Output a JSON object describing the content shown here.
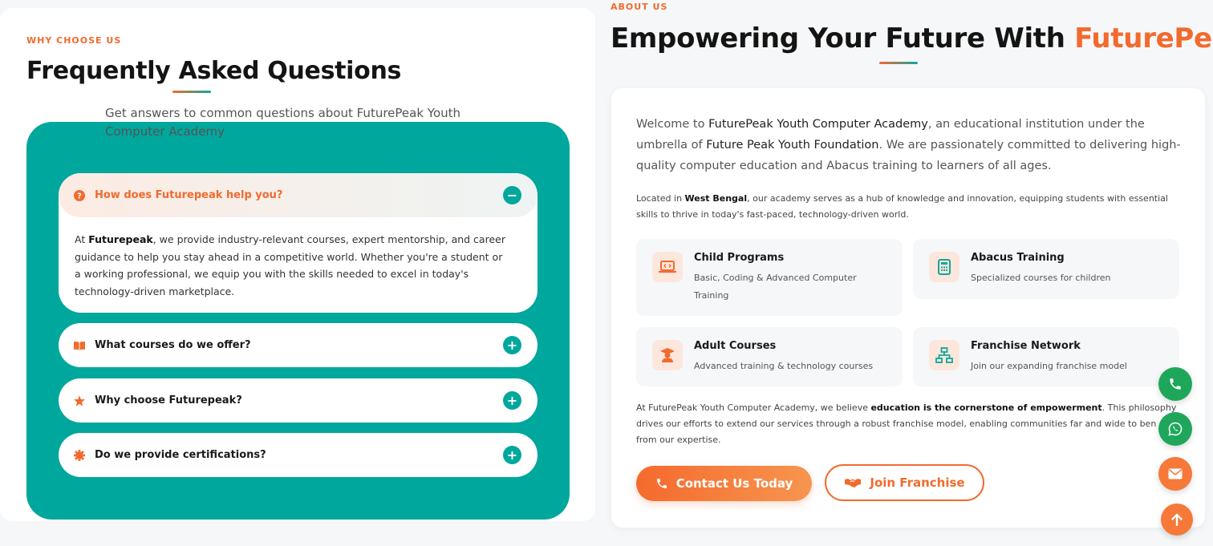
{
  "faq": {
    "eyebrow": "WHY CHOOSE US",
    "title": "Frequently Asked Questions",
    "subtitle": "Get answers to common questions about FuturePeak Youth Computer Academy",
    "items": [
      {
        "question": "How does Futurepeak help you?",
        "icon": "question-circle-icon",
        "expanded": true,
        "answer_prefix": "At ",
        "answer_bold": "Futurepeak",
        "answer_rest": ", we provide industry-relevant courses, expert mentorship, and career guidance to help you stay ahead in a competitive world. Whether you're a student or a working professional, we equip you with the skills needed to excel in today's technology-driven marketplace.",
        "toggle": "−"
      },
      {
        "question": "What courses do we offer?",
        "icon": "book-icon",
        "expanded": false,
        "toggle": "+"
      },
      {
        "question": "Why choose Futurepeak?",
        "icon": "star-icon",
        "expanded": false,
        "toggle": "+"
      },
      {
        "question": "Do we provide certifications?",
        "icon": "certificate-icon",
        "expanded": false,
        "toggle": "+"
      }
    ]
  },
  "about": {
    "eyebrow": "ABOUT US",
    "title_main": "Empowering Your Future With ",
    "title_accent": "FuturePeak",
    "lead": {
      "p1": "Welcome to ",
      "b1": "FuturePeak Youth Computer Academy",
      "p2": ", an educational institution under the umbrella of ",
      "b2": "Future Peak Youth Foundation",
      "p3": ". We are passionately committed to delivering high-quality computer education and Abacus training to learners of all ages."
    },
    "para": {
      "p1": "Located in ",
      "b1": "West Bengal",
      "p2": ", our academy serves as a hub of knowledge and innovation, equipping students with essential skills to thrive in today's fast-paced, technology-driven world."
    },
    "features": [
      {
        "title": "Child Programs",
        "desc": "Basic, Coding & Advanced Computer Training",
        "icon": "laptop-code-icon"
      },
      {
        "title": "Abacus Training",
        "desc": "Specialized courses for children",
        "icon": "calculator-icon"
      },
      {
        "title": "Adult Courses",
        "desc": "Advanced training & technology courses",
        "icon": "graduate-icon"
      },
      {
        "title": "Franchise Network",
        "desc": "Join our expanding franchise model",
        "icon": "network-icon"
      }
    ],
    "para2": {
      "p1": "At FuturePeak Youth Computer Academy, we believe ",
      "b1": "education is the cornerstone of empowerment",
      "p2": ". This philosophy",
      "line2": "drives our efforts to extend our services through a robust franchise model, enabling communities far and wide to ben",
      "line3": "from our expertise."
    },
    "buttons": {
      "contact": "Contact Us Today",
      "franchise": "Join Franchise"
    }
  },
  "floating": {
    "phone_icon": "phone-icon",
    "whatsapp_icon": "whatsapp-icon",
    "mail_icon": "mail-icon",
    "up_icon": "arrow-up-icon"
  },
  "colors": {
    "accent": "#f26a2e",
    "teal": "#00a79d",
    "green": "#1ea75a"
  }
}
